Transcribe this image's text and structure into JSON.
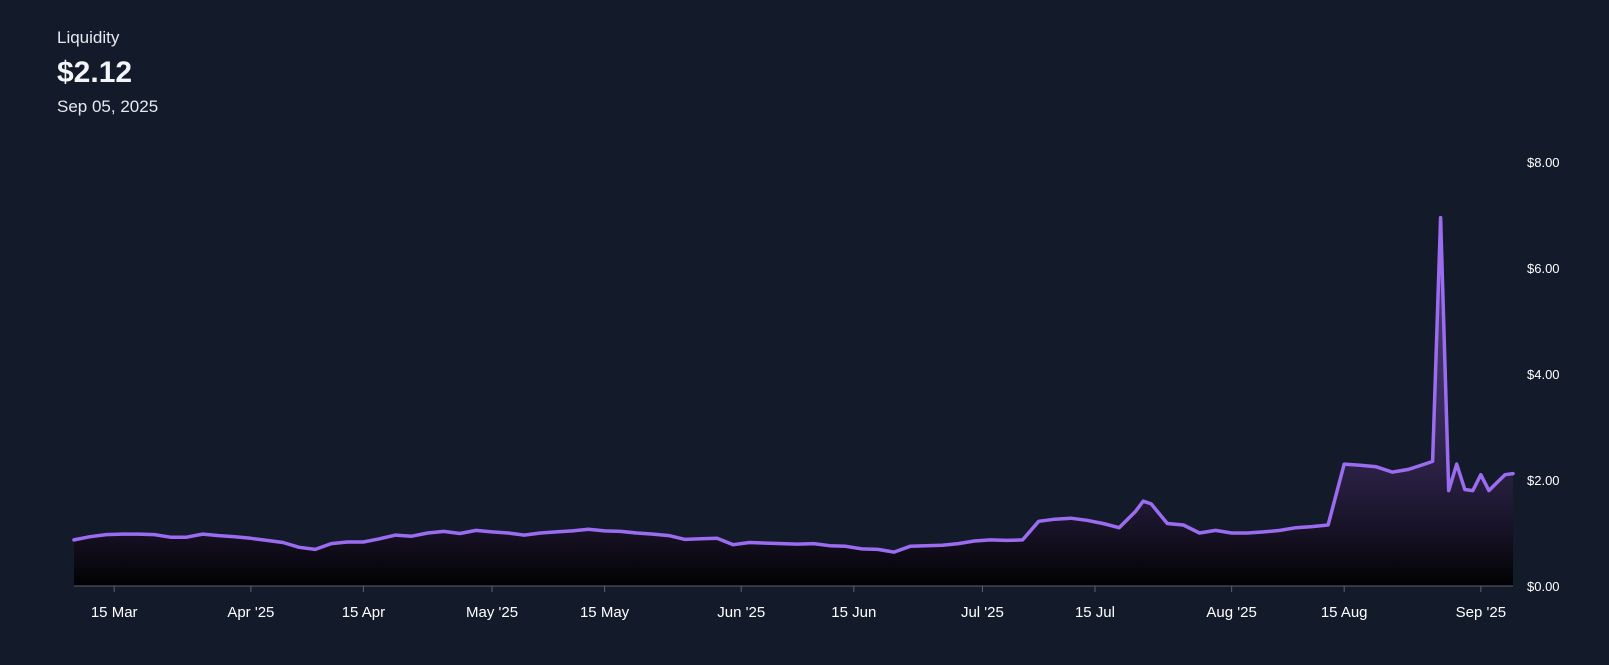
{
  "header": {
    "label": "Liquidity",
    "value": "$2.12",
    "date": "Sep 05, 2025"
  },
  "colors": {
    "background": "#131a2a",
    "line": "#9b6cf0",
    "axis": "#5a6072"
  },
  "chart_data": {
    "type": "area",
    "title": "Liquidity",
    "xlabel": "",
    "ylabel": "",
    "ylim": [
      0,
      8
    ],
    "grid": false,
    "y_ticks": [
      "$0.00",
      "$2.00",
      "$4.00",
      "$6.00",
      "$8.00"
    ],
    "x_ticks": [
      {
        "label": "15 Mar",
        "date": "2025-03-15"
      },
      {
        "label": "Apr '25",
        "date": "2025-04-01"
      },
      {
        "label": "15 Apr",
        "date": "2025-04-15"
      },
      {
        "label": "May '25",
        "date": "2025-05-01"
      },
      {
        "label": "15 May",
        "date": "2025-05-15"
      },
      {
        "label": "Jun '25",
        "date": "2025-06-01"
      },
      {
        "label": "15 Jun",
        "date": "2025-06-15"
      },
      {
        "label": "Jul '25",
        "date": "2025-07-01"
      },
      {
        "label": "15 Jul",
        "date": "2025-07-15"
      },
      {
        "label": "Aug '25",
        "date": "2025-08-01"
      },
      {
        "label": "15 Aug",
        "date": "2025-08-15"
      },
      {
        "label": "Sep '25",
        "date": "2025-09-01"
      }
    ],
    "series": [
      {
        "points": [
          [
            "2025-03-10",
            0.87
          ],
          [
            "2025-03-12",
            0.93
          ],
          [
            "2025-03-14",
            0.97
          ],
          [
            "2025-03-16",
            0.98
          ],
          [
            "2025-03-18",
            0.98
          ],
          [
            "2025-03-20",
            0.97
          ],
          [
            "2025-03-22",
            0.92
          ],
          [
            "2025-03-24",
            0.92
          ],
          [
            "2025-03-26",
            0.98
          ],
          [
            "2025-03-28",
            0.95
          ],
          [
            "2025-03-30",
            0.93
          ],
          [
            "2025-04-01",
            0.9
          ],
          [
            "2025-04-03",
            0.86
          ],
          [
            "2025-04-05",
            0.82
          ],
          [
            "2025-04-07",
            0.73
          ],
          [
            "2025-04-09",
            0.69
          ],
          [
            "2025-04-11",
            0.8
          ],
          [
            "2025-04-13",
            0.83
          ],
          [
            "2025-04-15",
            0.83
          ],
          [
            "2025-04-17",
            0.89
          ],
          [
            "2025-04-19",
            0.96
          ],
          [
            "2025-04-21",
            0.94
          ],
          [
            "2025-04-23",
            1.0
          ],
          [
            "2025-04-25",
            1.03
          ],
          [
            "2025-04-27",
            0.99
          ],
          [
            "2025-04-29",
            1.05
          ],
          [
            "2025-05-01",
            1.02
          ],
          [
            "2025-05-03",
            1.0
          ],
          [
            "2025-05-05",
            0.96
          ],
          [
            "2025-05-07",
            1.0
          ],
          [
            "2025-05-09",
            1.02
          ],
          [
            "2025-05-11",
            1.04
          ],
          [
            "2025-05-13",
            1.07
          ],
          [
            "2025-05-15",
            1.04
          ],
          [
            "2025-05-17",
            1.03
          ],
          [
            "2025-05-19",
            1.0
          ],
          [
            "2025-05-21",
            0.98
          ],
          [
            "2025-05-23",
            0.95
          ],
          [
            "2025-05-25",
            0.88
          ],
          [
            "2025-05-27",
            0.89
          ],
          [
            "2025-05-29",
            0.9
          ],
          [
            "2025-05-31",
            0.78
          ],
          [
            "2025-06-02",
            0.82
          ],
          [
            "2025-06-04",
            0.81
          ],
          [
            "2025-06-06",
            0.8
          ],
          [
            "2025-06-08",
            0.79
          ],
          [
            "2025-06-10",
            0.8
          ],
          [
            "2025-06-12",
            0.76
          ],
          [
            "2025-06-14",
            0.75
          ],
          [
            "2025-06-16",
            0.7
          ],
          [
            "2025-06-18",
            0.69
          ],
          [
            "2025-06-20",
            0.64
          ],
          [
            "2025-06-22",
            0.75
          ],
          [
            "2025-06-24",
            0.76
          ],
          [
            "2025-06-26",
            0.77
          ],
          [
            "2025-06-28",
            0.8
          ],
          [
            "2025-06-30",
            0.85
          ],
          [
            "2025-07-02",
            0.87
          ],
          [
            "2025-07-04",
            0.86
          ],
          [
            "2025-07-06",
            0.87
          ],
          [
            "2025-07-08",
            1.22
          ],
          [
            "2025-07-10",
            1.26
          ],
          [
            "2025-07-12",
            1.28
          ],
          [
            "2025-07-14",
            1.24
          ],
          [
            "2025-07-16",
            1.18
          ],
          [
            "2025-07-18",
            1.1
          ],
          [
            "2025-07-20",
            1.4
          ],
          [
            "2025-07-21",
            1.6
          ],
          [
            "2025-07-22",
            1.55
          ],
          [
            "2025-07-24",
            1.18
          ],
          [
            "2025-07-26",
            1.15
          ],
          [
            "2025-07-28",
            1.0
          ],
          [
            "2025-07-30",
            1.05
          ],
          [
            "2025-08-01",
            1.0
          ],
          [
            "2025-08-03",
            1.0
          ],
          [
            "2025-08-05",
            1.02
          ],
          [
            "2025-08-07",
            1.05
          ],
          [
            "2025-08-09",
            1.1
          ],
          [
            "2025-08-11",
            1.12
          ],
          [
            "2025-08-13",
            1.15
          ],
          [
            "2025-08-15",
            2.3
          ],
          [
            "2025-08-17",
            2.28
          ],
          [
            "2025-08-19",
            2.25
          ],
          [
            "2025-08-21",
            2.15
          ],
          [
            "2025-08-23",
            2.2
          ],
          [
            "2025-08-25",
            2.3
          ],
          [
            "2025-08-26",
            2.35
          ],
          [
            "2025-08-27",
            6.95
          ],
          [
            "2025-08-28",
            1.8
          ],
          [
            "2025-08-29",
            2.3
          ],
          [
            "2025-08-30",
            1.82
          ],
          [
            "2025-08-31",
            1.8
          ],
          [
            "2025-09-01",
            2.1
          ],
          [
            "2025-09-02",
            1.8
          ],
          [
            "2025-09-03",
            1.95
          ],
          [
            "2025-09-04",
            2.1
          ],
          [
            "2025-09-05",
            2.12
          ]
        ]
      }
    ]
  }
}
